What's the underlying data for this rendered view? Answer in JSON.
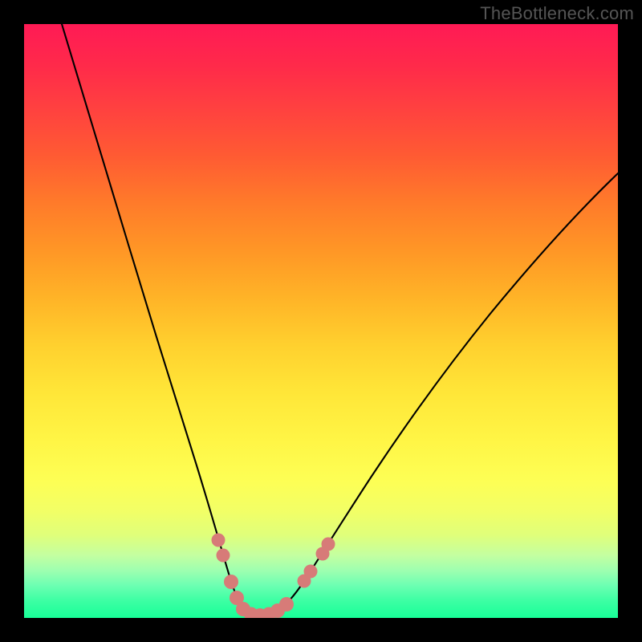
{
  "watermark": {
    "text": "TheBottleneck.com"
  },
  "colors": {
    "background": "#000000",
    "curve": "#000000",
    "markers": "#d77b78",
    "gradient_top": "#ff1a55",
    "gradient_bottom": "#18ff98"
  },
  "chart_data": {
    "type": "line",
    "title": "",
    "xlabel": "",
    "ylabel": "",
    "xlim": [
      0,
      100
    ],
    "ylim": [
      0,
      100
    ],
    "grid": false,
    "legend": false,
    "annotations": [
      "TheBottleneck.com"
    ],
    "note": "V-shaped bottleneck curve; y ≈ 0 near minimum band (green zone), rising steeply toward red at extremes. Values estimated from pixel positions.",
    "series": [
      {
        "name": "bottleneck-curve",
        "x": [
          6,
          10,
          14,
          18,
          22,
          26,
          30,
          33,
          35,
          36.5,
          38,
          40,
          42,
          45,
          50,
          56,
          62,
          70,
          78,
          86,
          94,
          100
        ],
        "y": [
          100,
          88,
          75,
          62,
          49,
          36,
          23,
          12,
          6,
          2,
          0,
          0,
          0,
          2,
          8,
          17,
          26,
          37,
          47,
          55,
          62,
          67
        ]
      }
    ],
    "markers": {
      "name": "highlight-dots",
      "points": [
        {
          "x": 32.8,
          "y": 13
        },
        {
          "x": 33.6,
          "y": 10
        },
        {
          "x": 35.0,
          "y": 5
        },
        {
          "x": 36.0,
          "y": 2
        },
        {
          "x": 37.3,
          "y": 0.5
        },
        {
          "x": 38.7,
          "y": 0
        },
        {
          "x": 40.0,
          "y": 0
        },
        {
          "x": 41.5,
          "y": 0
        },
        {
          "x": 43.0,
          "y": 0.5
        },
        {
          "x": 44.5,
          "y": 1.8
        },
        {
          "x": 47.5,
          "y": 5.5
        },
        {
          "x": 48.5,
          "y": 7
        },
        {
          "x": 50.5,
          "y": 10
        },
        {
          "x": 51.5,
          "y": 12
        }
      ]
    }
  }
}
